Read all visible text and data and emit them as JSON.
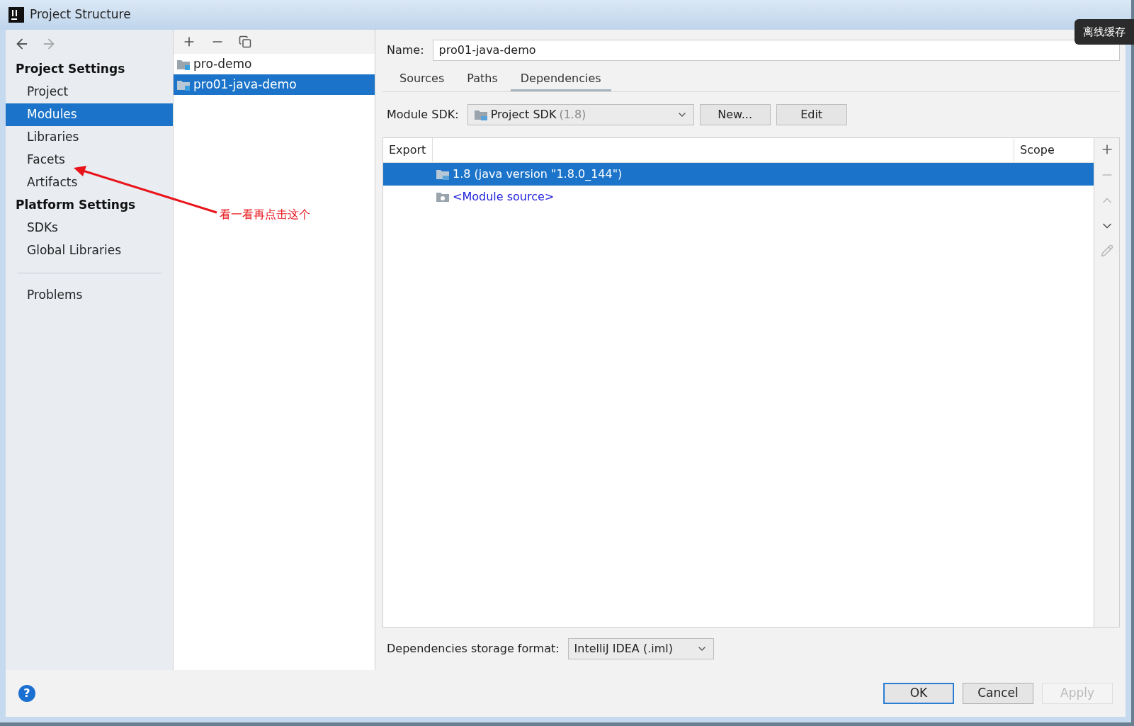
{
  "window": {
    "title": "Project Structure"
  },
  "sidebar": {
    "sections": [
      {
        "heading": "Project Settings",
        "items": [
          {
            "label": "Project",
            "selected": false
          },
          {
            "label": "Modules",
            "selected": true
          },
          {
            "label": "Libraries",
            "selected": false
          },
          {
            "label": "Facets",
            "selected": false
          },
          {
            "label": "Artifacts",
            "selected": false
          }
        ]
      },
      {
        "heading": "Platform Settings",
        "items": [
          {
            "label": "SDKs",
            "selected": false
          },
          {
            "label": "Global Libraries",
            "selected": false
          }
        ]
      }
    ],
    "footer_items": [
      {
        "label": "Problems",
        "selected": false
      }
    ]
  },
  "modules": [
    {
      "name": "pro-demo",
      "selected": false
    },
    {
      "name": "pro01-java-demo",
      "selected": true
    }
  ],
  "detail": {
    "name_label": "Name:",
    "name_value": "pro01-java-demo",
    "tabs": [
      {
        "label": "Sources",
        "selected": false
      },
      {
        "label": "Paths",
        "selected": false
      },
      {
        "label": "Dependencies",
        "selected": true
      }
    ],
    "sdk_label": "Module SDK:",
    "sdk_value": "Project SDK",
    "sdk_version": "(1.8)",
    "sdk_buttons": [
      "New...",
      "Edit"
    ],
    "columns": [
      "Export",
      "Scope"
    ],
    "rows": [
      {
        "kind": "sdk",
        "label": "1.8 (java version \"1.8.0_144\")",
        "selected": true
      },
      {
        "kind": "source",
        "label": "<Module source>",
        "selected": false
      }
    ],
    "format_label": "Dependencies storage format:",
    "format_value": "IntelliJ IDEA (.iml)"
  },
  "footer": {
    "help": "?",
    "buttons": [
      {
        "label": "OK",
        "default": true,
        "disabled": false
      },
      {
        "label": "Cancel",
        "default": false,
        "disabled": false
      },
      {
        "label": "Apply",
        "default": false,
        "disabled": true
      }
    ]
  },
  "annotation": {
    "text": "看一看再点击这个"
  },
  "overlay_button": "离线缓存"
}
